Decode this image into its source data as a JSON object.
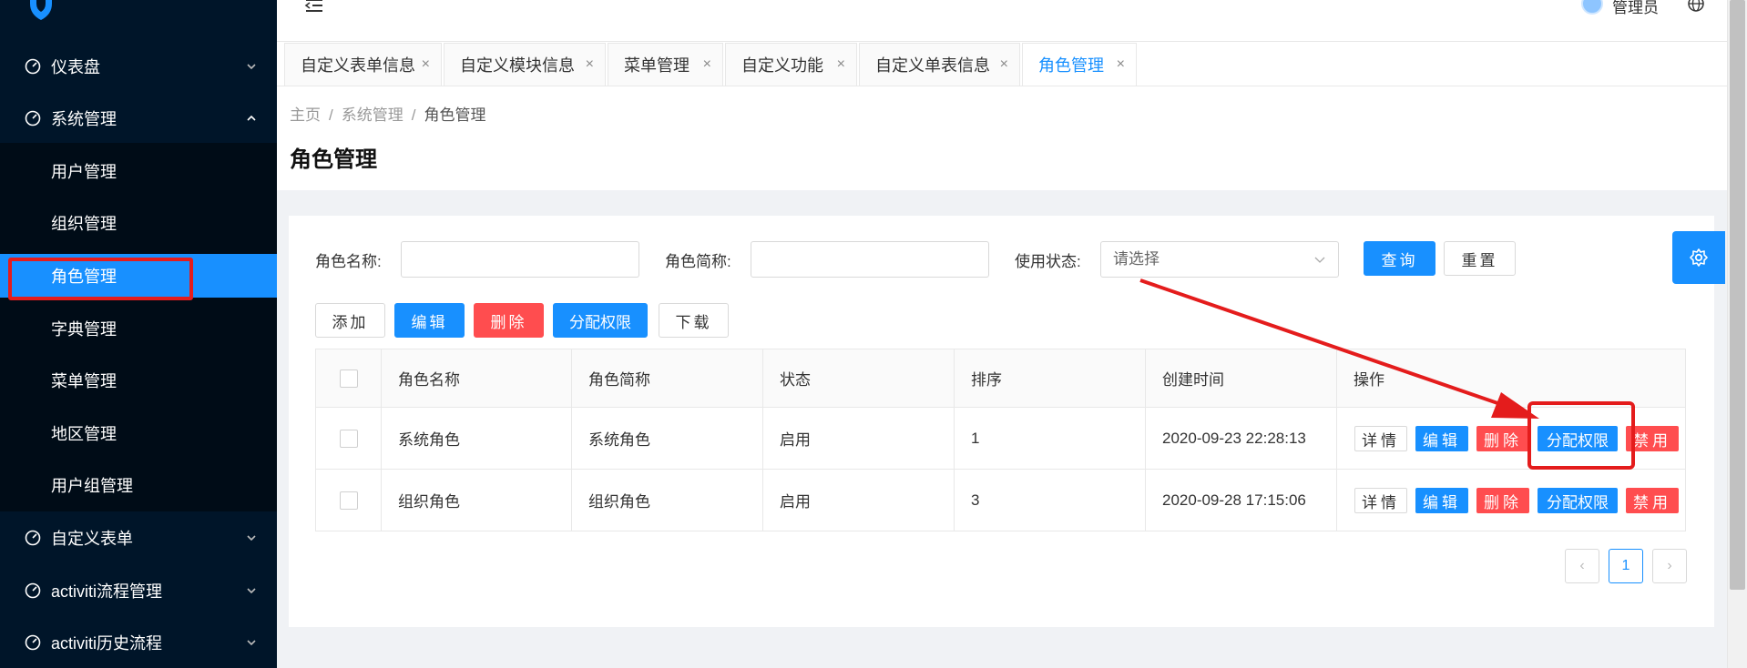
{
  "sidebar": {
    "menu": [
      {
        "label": "仪表盘",
        "icon": "dashboard-icon",
        "arrow": "chevron-down-icon"
      },
      {
        "label": "系统管理",
        "icon": "dashboard-icon",
        "arrow": "chevron-up-icon"
      },
      {
        "label": "自定义表单",
        "icon": "dashboard-icon",
        "arrow": "chevron-down-icon"
      },
      {
        "label": "activiti流程管理",
        "icon": "dashboard-icon",
        "arrow": "chevron-down-icon"
      },
      {
        "label": "activiti历史流程",
        "icon": "dashboard-icon",
        "arrow": "chevron-down-icon"
      }
    ],
    "submenu": [
      {
        "label": "用户管理"
      },
      {
        "label": "组织管理"
      },
      {
        "label": "角色管理"
      },
      {
        "label": "字典管理"
      },
      {
        "label": "菜单管理"
      },
      {
        "label": "地区管理"
      },
      {
        "label": "用户组管理"
      }
    ],
    "active_submenu": "角色管理"
  },
  "header": {
    "user_name": "管理员"
  },
  "tabs": [
    {
      "label": "自定义表单信息",
      "close": "×"
    },
    {
      "label": "自定义模块信息",
      "close": "×"
    },
    {
      "label": "菜单管理",
      "close": "×"
    },
    {
      "label": "自定义功能",
      "close": "×"
    },
    {
      "label": "自定义单表信息",
      "close": "×"
    },
    {
      "label": "角色管理",
      "close": "×"
    }
  ],
  "breadcrumb": {
    "items": [
      "主页",
      "系统管理",
      "角色管理"
    ],
    "separator": "/"
  },
  "page_title": "角色管理",
  "filters": {
    "role_name_label": "角色名称:",
    "role_short_label": "角色简称:",
    "status_label": "使用状态:",
    "status_placeholder": "请选择",
    "query_button": "查询",
    "reset_button": "重置"
  },
  "toolbar": {
    "add": "添加",
    "edit": "编辑",
    "delete": "删除",
    "assign": "分配权限",
    "download": "下载"
  },
  "table": {
    "columns": [
      "角色名称",
      "角色简称",
      "状态",
      "排序",
      "创建时间",
      "操作"
    ],
    "rows": [
      {
        "name": "系统角色",
        "short": "系统角色",
        "status": "启用",
        "order": "1",
        "created": "2020-09-23 22:28:13"
      },
      {
        "name": "组织角色",
        "short": "组织角色",
        "status": "启用",
        "order": "3",
        "created": "2020-09-28 17:15:06"
      }
    ],
    "actions": {
      "detail": "详情",
      "edit": "编辑",
      "delete": "删除",
      "assign": "分配权限",
      "disable": "禁用"
    }
  },
  "pager": {
    "prev": "‹",
    "current": "1",
    "next": "›"
  },
  "colors": {
    "sidebar_bg": "#001529",
    "submenu_bg": "#000c17",
    "primary": "#1890ff",
    "danger": "#ff4d4f",
    "annotation": "#e41c1c"
  }
}
